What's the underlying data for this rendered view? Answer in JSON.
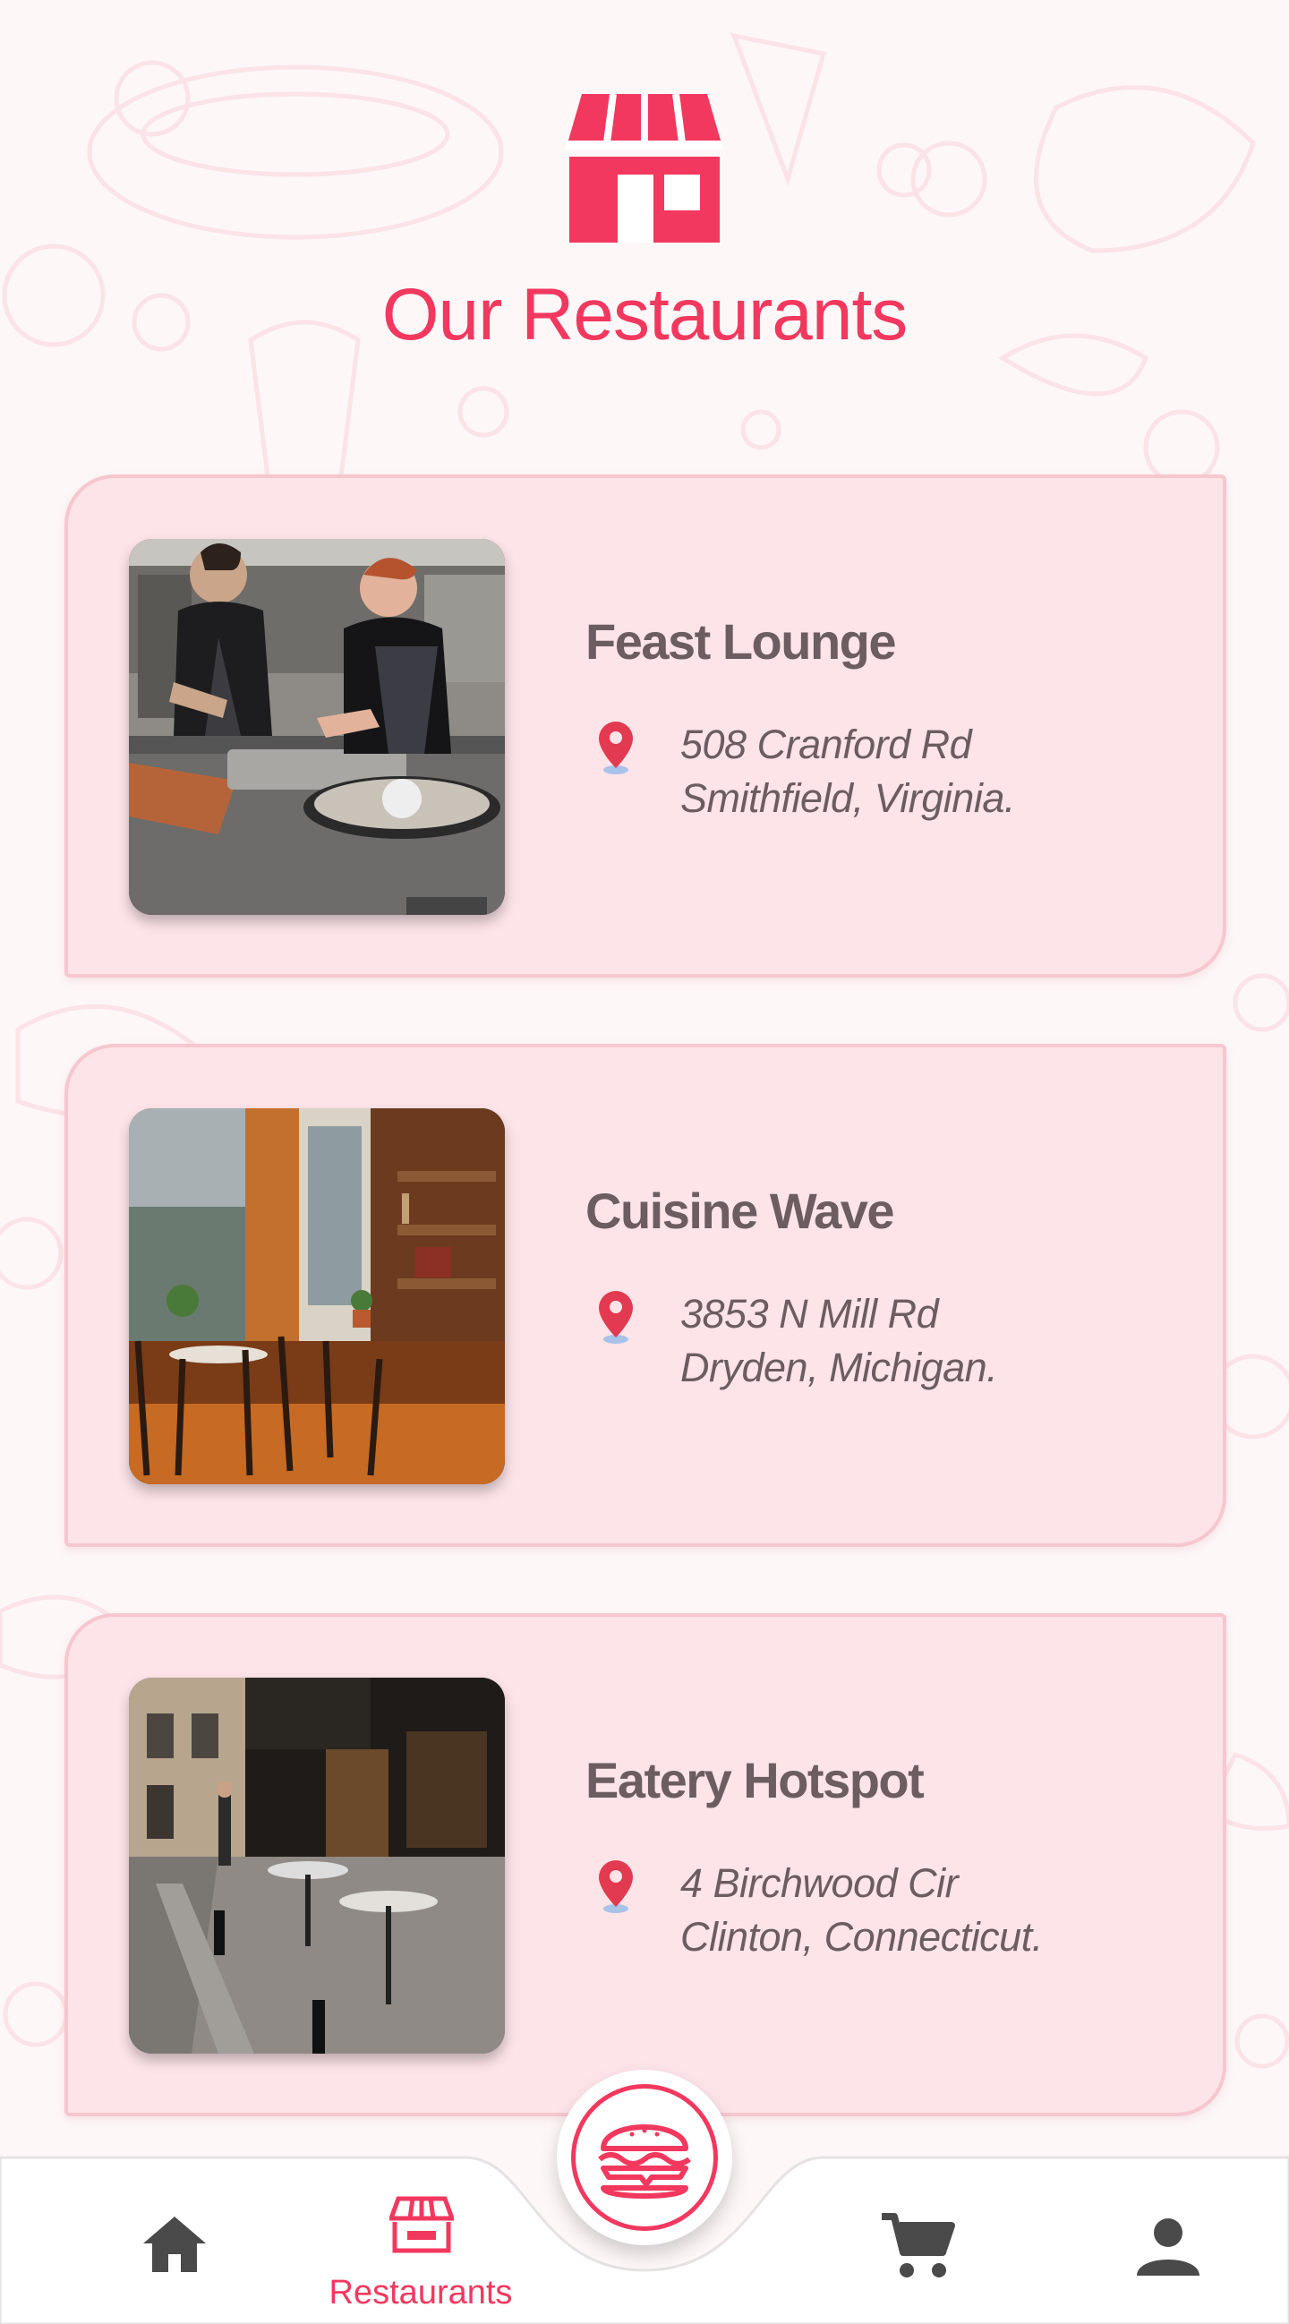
{
  "page": {
    "title": "Our Restaurants",
    "accent_color": "#f2385e",
    "header_icon": "store-icon"
  },
  "restaurants": [
    {
      "name": "Feast Lounge",
      "address_line1": "508 Cranford Rd",
      "address_line2": "Smithfield, Virginia.",
      "photo": "chefs-preparing-oysters-in-kitchen"
    },
    {
      "name": "Cuisine Wave",
      "address_line1": "3853 N Mill Rd",
      "address_line2": "Dryden, Michigan.",
      "photo": "cozy-cafe-interior-with-bookshelves"
    },
    {
      "name": "Eatery Hotspot",
      "address_line1": "4 Birchwood Cir",
      "address_line2": "Clinton, Connecticut.",
      "photo": "street-cafe-outdoor-seating"
    }
  ],
  "bottom_nav": {
    "items": [
      {
        "id": "home",
        "icon": "home-icon"
      },
      {
        "id": "restaurants",
        "icon": "store-icon",
        "label": "Restaurants",
        "active": true
      },
      {
        "id": "cart",
        "icon": "cart-icon"
      },
      {
        "id": "profile",
        "icon": "person-icon"
      }
    ],
    "center_button_icon": "burger-icon"
  }
}
